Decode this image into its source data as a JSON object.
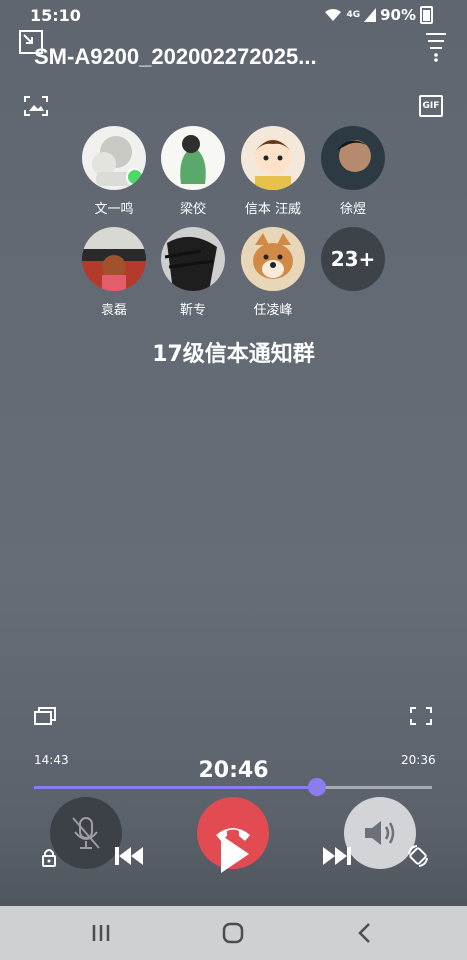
{
  "status": {
    "time": "15:10",
    "network": "4G",
    "battery": "90%"
  },
  "header": {
    "title": "SM-A9200_202002272025..."
  },
  "participants": [
    {
      "name": "文一鸣",
      "speaking": true,
      "bg": "#f0f0ee"
    },
    {
      "name": "梁佼",
      "speaking": false,
      "bg": "#f7f7f4"
    },
    {
      "name": "信本  汪威",
      "speaking": false,
      "bg": "#f4e8da"
    },
    {
      "name": "徐煜",
      "speaking": false,
      "bg": "#2d3a44"
    },
    {
      "name": "袁磊",
      "speaking": false,
      "bg": "#b43a2e"
    },
    {
      "name": "靳专",
      "speaking": false,
      "bg": "#3a3a3a"
    },
    {
      "name": "任凌峰",
      "speaking": false,
      "bg": "#d9a36a"
    }
  ],
  "more_count": "23+",
  "group_name": "17级信本通知群",
  "player": {
    "elapsed": "14:43",
    "current": "20:46",
    "total": "20:36",
    "progress": 0.71
  },
  "colors": {
    "accent": "#8c7cf0",
    "hangup": "#e24b52"
  }
}
